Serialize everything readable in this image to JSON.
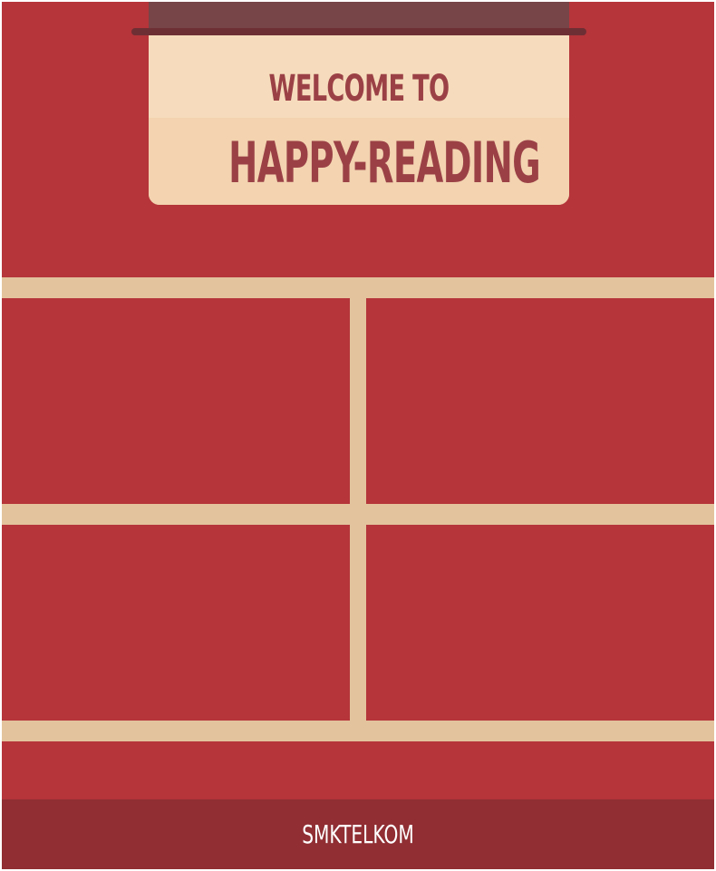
{
  "sign": {
    "line1": "WELCOME TO",
    "line2": "HAPPY-READING"
  },
  "footer": {
    "label": "SMKTELKOM"
  },
  "colors": {
    "wall": "#b5353a",
    "strap": "#774548",
    "rod": "#6e2f34",
    "sign_top": "#f6dcbc",
    "sign_bottom": "#f3d3b0",
    "sign_text": "#9b4146",
    "shelf": "#e3c39d",
    "footer_bg": "#902e33",
    "footer_text": "#ffffff"
  }
}
